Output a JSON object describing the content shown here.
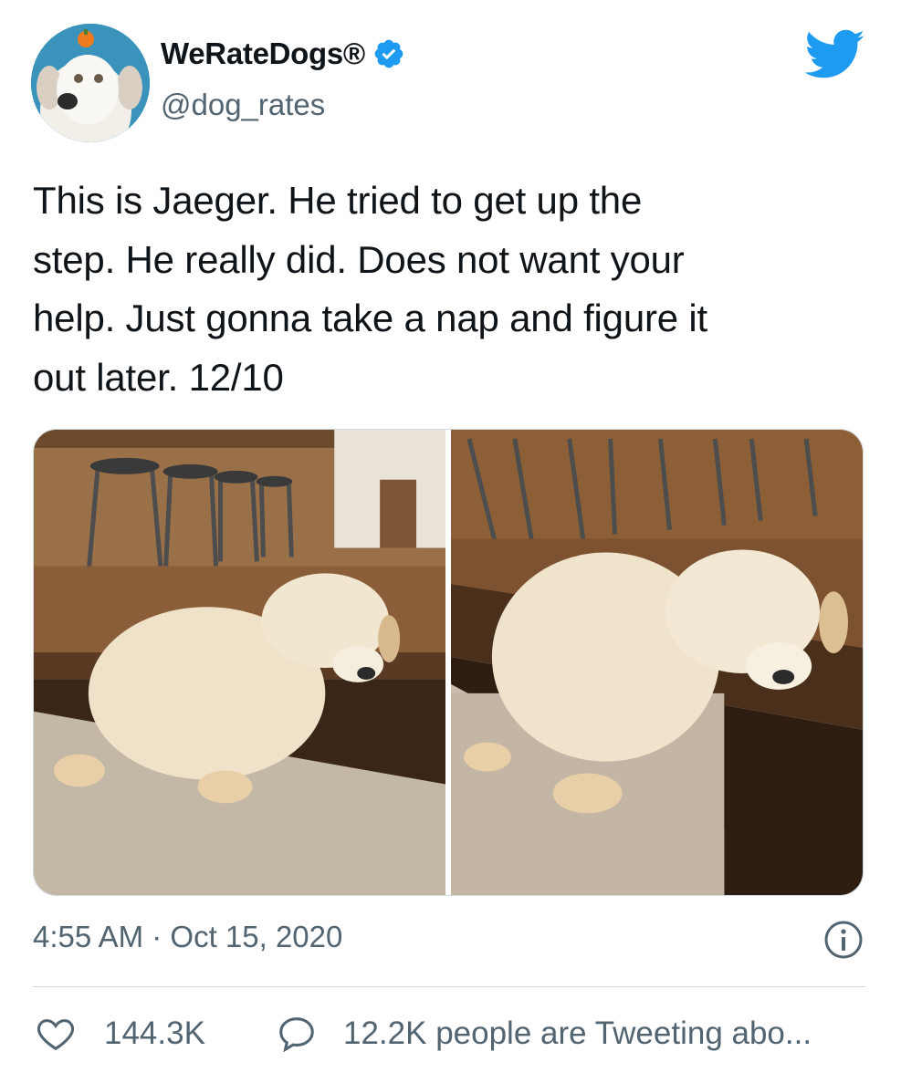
{
  "user": {
    "display_name": "WeRateDogs®",
    "handle": "@dog_rates",
    "avatar_icon": "dog-avatar-icon",
    "verified_icon": "verified-badge-icon"
  },
  "brand": {
    "logo_icon": "twitter-bird-icon",
    "accent": "#1d9bf0"
  },
  "tweet": {
    "text": "This is Jaeger. He tried to get up the\nstep. He really did. Does not want your\nhelp. Just gonna take a nap and figure it\nout later. 12/10",
    "photos": [
      {
        "icon": "puppy-photo-1"
      },
      {
        "icon": "puppy-photo-2"
      }
    ],
    "timestamp": "4:55 AM · Oct 15, 2020"
  },
  "actions": {
    "like_count": "144.3K",
    "reply_text": "12.2K people are Tweeting abo..."
  },
  "colors": {
    "text": "#0f1419",
    "secondary": "#536471",
    "border": "#cfd9de"
  }
}
